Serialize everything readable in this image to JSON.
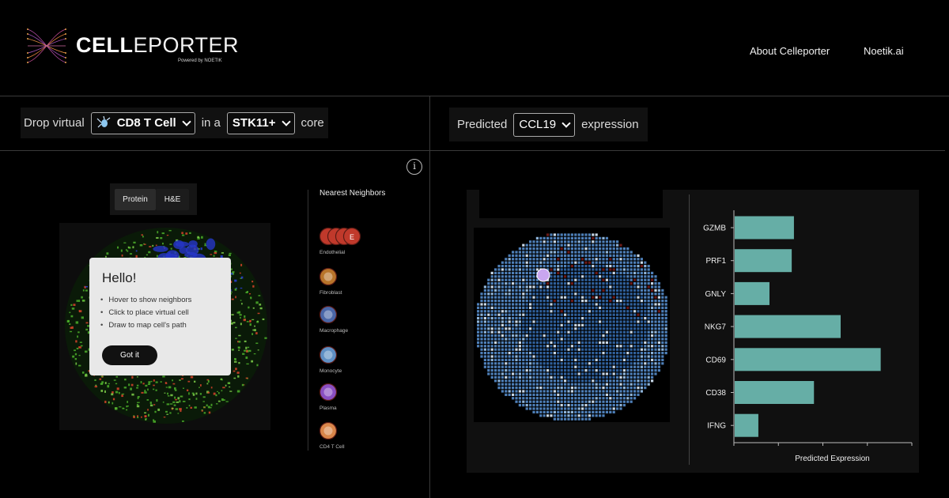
{
  "header": {
    "brand_bold": "CELL",
    "brand_rest": "EPORTER",
    "powered_by": "Powered by NOETIK",
    "nav": [
      {
        "label": "About Celleporter"
      },
      {
        "label": "Noetik.ai"
      }
    ]
  },
  "left_controls": {
    "prefix": "Drop virtual",
    "cell_type": "CD8 T Cell",
    "middle": "in a",
    "core_type": "STK11+",
    "suffix": "core"
  },
  "right_controls": {
    "prefix": "Predicted",
    "gene": "CCL19",
    "suffix": "expression"
  },
  "view_toggle": {
    "options": [
      "Protein",
      "H&E"
    ],
    "selected": "Protein"
  },
  "hello_card": {
    "title": "Hello!",
    "items": [
      "Hover to show neighbors",
      "Click to place virtual cell",
      "Draw to map cell's path"
    ],
    "button": "Got it"
  },
  "neighbors": {
    "title": "Nearest Neighbors",
    "items": [
      {
        "label": "Endothelial",
        "color": "#c0392b",
        "count": 4,
        "badge": "E"
      },
      {
        "label": "Fibroblast",
        "color": "#b8742a",
        "count": 1
      },
      {
        "label": "Macrophage",
        "color": "#4a67a8",
        "count": 1
      },
      {
        "label": "Monocyte",
        "color": "#5f8fc4",
        "count": 1
      },
      {
        "label": "Plasma",
        "color": "#8a4fc2",
        "count": 1
      },
      {
        "label": "CD4 T Cell",
        "color": "#d9864a",
        "count": 1
      }
    ]
  },
  "chart_data": {
    "type": "bar",
    "orientation": "horizontal",
    "categories": [
      "GZMB",
      "PRF1",
      "GNLY",
      "NKG7",
      "CD69",
      "CD38",
      "IFNG"
    ],
    "values": [
      1.35,
      1.3,
      0.8,
      2.4,
      3.3,
      1.8,
      0.55
    ],
    "xlabel": "Predicted Expression",
    "xlim": [
      0,
      4
    ],
    "bar_color": "#66aea6"
  },
  "colors": {
    "accent": "#66aea6",
    "background": "#000000",
    "card": "#e8e8e8"
  }
}
